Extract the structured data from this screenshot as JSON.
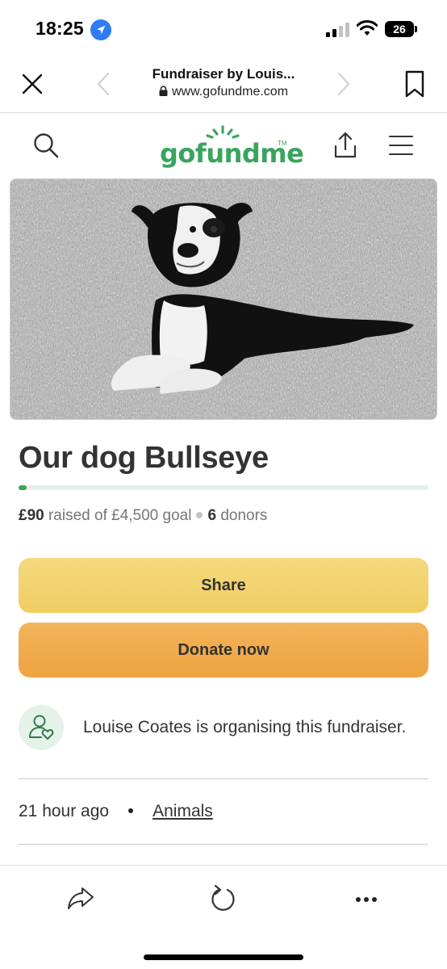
{
  "status_bar": {
    "time": "18:25",
    "battery": "26"
  },
  "browser": {
    "page_title": "Fundraiser by Louis...",
    "url": "www.gofundme.com"
  },
  "site": {
    "logo_text": "gofundme",
    "logo_tm": "TM"
  },
  "hero": {
    "icon": "dog-photo"
  },
  "campaign": {
    "title": "Our dog Bullseye",
    "raised": "£90",
    "raised_label": "raised of £4,500 goal",
    "donor_count": "6",
    "donors_label": "donors",
    "progress_fraction": 0.02
  },
  "actions": {
    "share_label": "Share",
    "donate_label": "Donate now"
  },
  "organiser": {
    "text": "Louise Coates is organising this fundraiser."
  },
  "meta": {
    "time_ago": "21 hour ago",
    "category": "Animals"
  },
  "colors": {
    "brand_green": "#3aa45d",
    "share_yellow": "#f0cd62",
    "donate_orange": "#eda340"
  }
}
